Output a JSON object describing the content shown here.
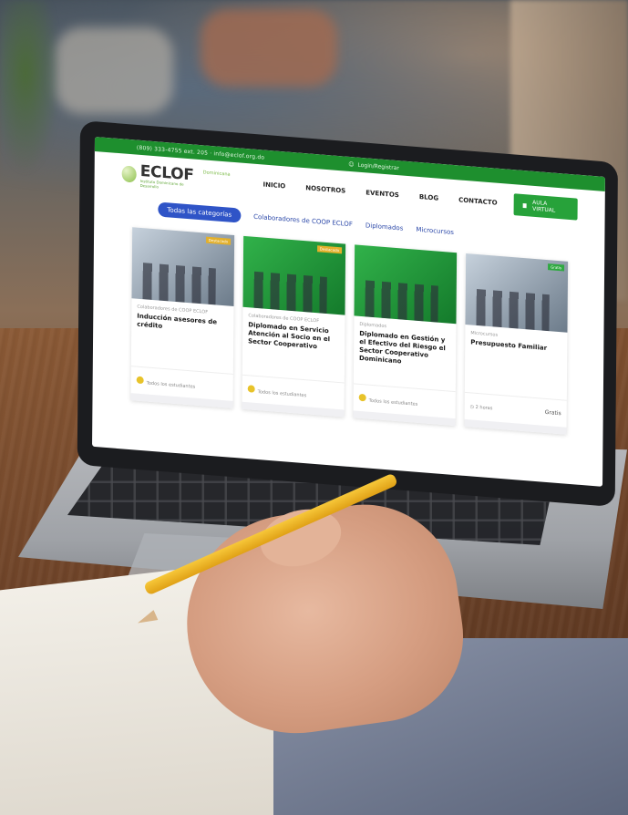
{
  "site": {
    "topbar": {
      "phone": "(809) 333-4755 ext. 205 · info@eclof.org.do",
      "login": "Login/Registrar"
    },
    "logo": {
      "name": "ECLOF",
      "tagline": "Dominicana",
      "subtitle": "Instituto Dominicano de Desarrollo"
    },
    "menu": [
      "INICIO",
      "NOSOTROS",
      "EVENTOS",
      "BLOG",
      "CONTACTO"
    ],
    "cta": "AULA VIRTUAL",
    "categories": [
      "Todas las categorías",
      "Colaboradores de COOP ECLOF",
      "Diplomados",
      "Microcursos"
    ],
    "cards": [
      {
        "badge": "Destacado",
        "category": "Colaboradores de COOP ECLOF",
        "title": "Inducción asesores de crédito",
        "footer": "Todos los estudiantes"
      },
      {
        "badge": "Destacado",
        "category": "Colaboradores de COOP ECLOF",
        "title": "Diplomado en Servicio Atención al Socio en el Sector Cooperativo",
        "footer": "Todos los estudiantes"
      },
      {
        "badge": "",
        "category": "Diplomados",
        "title": "Diplomado en Gestión y el Efectivo del Riesgo el Sector Cooperativo Dominicano",
        "footer": "Todos los estudiantes"
      },
      {
        "badge": "Gratis",
        "category": "Microcursos",
        "title": "Presupuesto Familiar",
        "footer": "2 horas",
        "price": "Gratis"
      }
    ]
  },
  "colors": {
    "brand_green": "#1e8f2e",
    "category_blue": "#2f54c7"
  }
}
